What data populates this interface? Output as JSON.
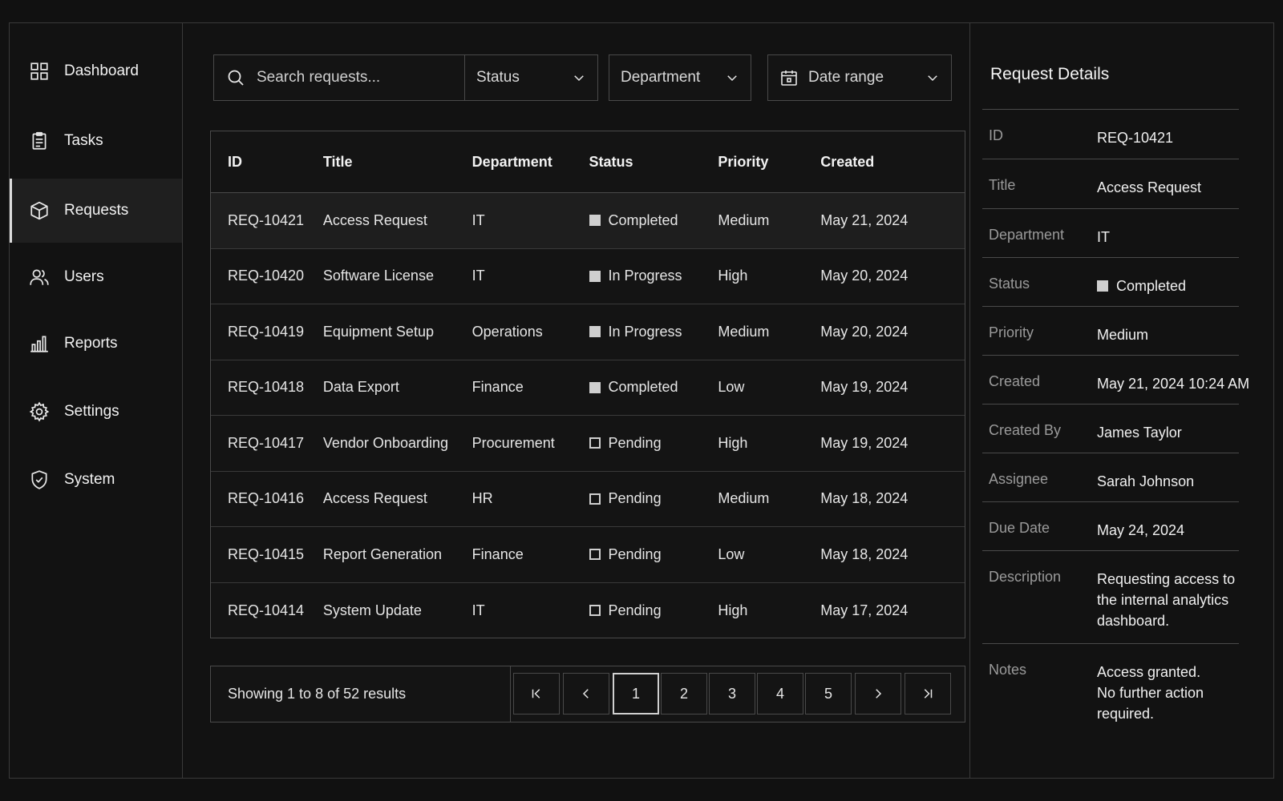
{
  "sidebar": {
    "items": [
      {
        "label": "Dashboard",
        "icon": "grid-icon"
      },
      {
        "label": "Tasks",
        "icon": "clipboard-icon"
      },
      {
        "label": "Requests",
        "icon": "box-icon"
      },
      {
        "label": "Users",
        "icon": "users-icon"
      },
      {
        "label": "Reports",
        "icon": "bar-chart-icon"
      },
      {
        "label": "Settings",
        "icon": "gear-icon"
      },
      {
        "label": "System",
        "icon": "shield-icon"
      }
    ],
    "active": "Requests"
  },
  "filters": {
    "search_placeholder": "Search requests...",
    "status": "Status",
    "department": "Department",
    "date_range": "Date range"
  },
  "table": {
    "columns": [
      "ID",
      "Title",
      "Department",
      "Status",
      "Priority",
      "Created"
    ],
    "rows": [
      {
        "id": "REQ-10421",
        "title": "Access Request",
        "department": "IT",
        "status": "Completed",
        "priority": "Medium",
        "created": "May 21, 2024"
      },
      {
        "id": "REQ-10420",
        "title": "Software License",
        "department": "IT",
        "status": "In Progress",
        "priority": "High",
        "created": "May 20, 2024"
      },
      {
        "id": "REQ-10419",
        "title": "Equipment Setup",
        "department": "Operations",
        "status": "In Progress",
        "priority": "Medium",
        "created": "May 20, 2024"
      },
      {
        "id": "REQ-10418",
        "title": "Data Export",
        "department": "Finance",
        "status": "Completed",
        "priority": "Low",
        "created": "May 19, 2024"
      },
      {
        "id": "REQ-10417",
        "title": "Vendor Onboarding",
        "department": "Procurement",
        "status": "Pending",
        "priority": "High",
        "created": "May 19, 2024"
      },
      {
        "id": "REQ-10416",
        "title": "Access Request",
        "department": "HR",
        "status": "Pending",
        "priority": "Medium",
        "created": "May 18, 2024"
      },
      {
        "id": "REQ-10415",
        "title": "Report Generation",
        "department": "Finance",
        "status": "Pending",
        "priority": "Low",
        "created": "May 18, 2024"
      },
      {
        "id": "REQ-10414",
        "title": "System Update",
        "department": "IT",
        "status": "Pending",
        "priority": "High",
        "created": "May 17, 2024"
      }
    ]
  },
  "pagination": {
    "summary": "Showing 1 to 8 of 52 results",
    "pages": [
      "1",
      "2",
      "3",
      "4",
      "5"
    ],
    "current": "1"
  },
  "details": {
    "title": "Request Details",
    "fields": [
      {
        "key": "ID",
        "value": "REQ-10421"
      },
      {
        "key": "Title",
        "value": "Access Request"
      },
      {
        "key": "Department",
        "value": "IT"
      },
      {
        "key": "Status",
        "value": "Completed"
      },
      {
        "key": "Priority",
        "value": "Medium"
      },
      {
        "key": "Created",
        "value": "May 21, 2024 10:24 AM"
      },
      {
        "key": "Created By",
        "value": "James Taylor"
      },
      {
        "key": "Assignee",
        "value": "Sarah Johnson"
      },
      {
        "key": "Due Date",
        "value": "May 24, 2024"
      },
      {
        "key": "Description",
        "value": "Requesting access to\nthe internal analytics\ndashboard."
      },
      {
        "key": "Notes",
        "value": "Access granted.\nNo further action\nrequired."
      }
    ]
  },
  "colors": {
    "background": "#111111",
    "border": "#4a4a4a",
    "text": "#e6e6e6",
    "muted": "#9a9a9a",
    "status_marker": "#cfcfcf"
  }
}
